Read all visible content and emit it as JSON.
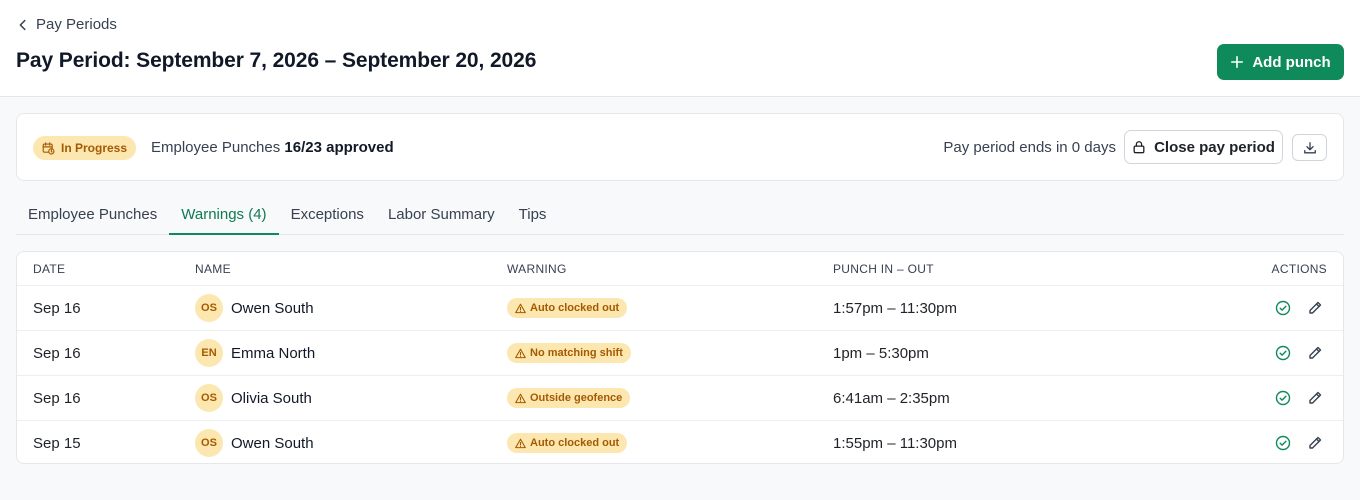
{
  "header": {
    "back_label": "Pay Periods",
    "title": "Pay Period: September 7, 2026 – September 20, 2026",
    "add_punch_label": "Add punch"
  },
  "status": {
    "badge": "In Progress",
    "punch_label": "Employee Punches",
    "approved": "16/23 approved",
    "ends_text": "Pay period ends in 0 days",
    "close_label": "Close pay period"
  },
  "tabs": [
    {
      "label": "Employee Punches"
    },
    {
      "label": "Warnings (4)"
    },
    {
      "label": "Exceptions"
    },
    {
      "label": "Labor Summary"
    },
    {
      "label": "Tips"
    }
  ],
  "table": {
    "columns": {
      "date": "DATE",
      "name": "NAME",
      "warning": "WARNING",
      "punch": "PUNCH IN – OUT",
      "actions": "ACTIONS"
    },
    "rows": [
      {
        "date": "Sep 16",
        "initials": "OS",
        "name": "Owen South",
        "warning": "Auto clocked out",
        "punch": "1:57pm – 11:30pm"
      },
      {
        "date": "Sep 16",
        "initials": "EN",
        "name": "Emma North",
        "warning": "No matching shift",
        "punch": "1pm – 5:30pm"
      },
      {
        "date": "Sep 16",
        "initials": "OS",
        "name": "Olivia South",
        "warning": "Outside geofence",
        "punch": "6:41am – 2:35pm"
      },
      {
        "date": "Sep 15",
        "initials": "OS",
        "name": "Owen South",
        "warning": "Auto clocked out",
        "punch": "1:55pm – 11:30pm"
      }
    ]
  },
  "colors": {
    "accent": "#0f8a5a",
    "warning_bg": "#fde7b0",
    "warning_text": "#a45a00"
  }
}
